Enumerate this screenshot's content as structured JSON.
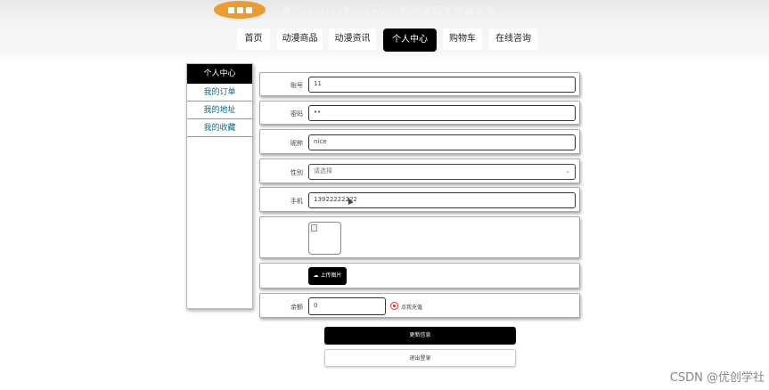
{
  "header": {
    "site_title": "基于 SpringBoot+Vue的动漫周边商城系统"
  },
  "nav": {
    "items": [
      "首页",
      "动漫商品",
      "动漫资讯",
      "个人中心",
      "购物车",
      "在线咨询"
    ],
    "active_index": 3
  },
  "sidebar": {
    "title": "个人中心",
    "items": [
      "我的订单",
      "我的地址",
      "我的收藏"
    ]
  },
  "form": {
    "account": {
      "label": "账号",
      "value": "11"
    },
    "password": {
      "label": "密码",
      "value": "••"
    },
    "nickname": {
      "label": "昵称",
      "value": "nice"
    },
    "gender": {
      "label": "性别",
      "placeholder": "请选择"
    },
    "phone": {
      "label": "手机",
      "value": "13922222222"
    },
    "upload_label": "上传图片",
    "balance": {
      "label": "余额",
      "value": "0"
    },
    "recharge_label": "点我充值"
  },
  "actions": {
    "update_label": "更新信息",
    "logout_label": "退出登录"
  },
  "watermark": "CSDN @优创学社",
  "colors": {
    "accent": "#000000",
    "sidebar_link": "#0e6c7d",
    "logo": "#ef9a2d",
    "radio": "#dd3333"
  }
}
